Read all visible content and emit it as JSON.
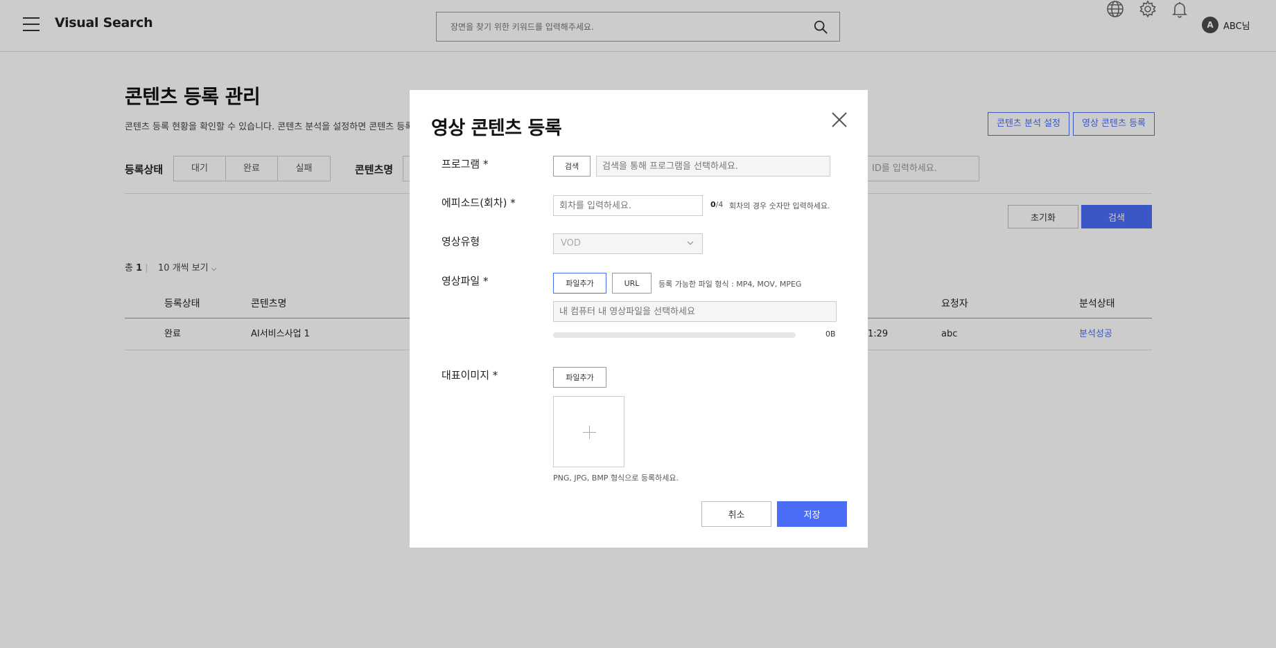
{
  "app": {
    "title": "Visual Search",
    "search_placeholder": "장면을 찾기 위한 키워드를 입력해주세요.",
    "user_initial": "A",
    "user_name": "ABC님"
  },
  "page": {
    "title": "콘텐츠 등록 관리",
    "description": "콘텐츠 등록 현황을 확인할 수 있습니다. 콘텐츠 분석을 설정하면 콘텐츠 등록",
    "analysis_settings_button": "콘텐츠 분석 설정",
    "register_video_button": "영상 콘텐츠 등록"
  },
  "filters": {
    "status_label": "등록상태",
    "status_options": [
      "대기",
      "완료",
      "실패"
    ],
    "content_name_label": "콘텐츠명",
    "id_placeholder": "ID를 입력하세요.",
    "reset_button": "초기화",
    "search_button": "검색"
  },
  "list": {
    "total_prefix": "총",
    "total_count": "1",
    "per_page": "10 개씩 보기",
    "columns": {
      "status": "등록상태",
      "content_name": "콘텐츠명",
      "requester": "요청자",
      "analysis_status": "분석상태"
    },
    "rows": [
      {
        "status": "완료",
        "content_name": "AI서비스사업 1",
        "time": "1:29",
        "requester": "abc",
        "analysis_status": "분석성공"
      }
    ]
  },
  "modal": {
    "title": "영상 콘텐츠 등록",
    "program": {
      "label": "프로그램 *",
      "search_button": "검색",
      "placeholder": "검색을 통해 프로그램을 선택하세요."
    },
    "episode": {
      "label": "에피소드(회차) *",
      "placeholder": "회차를 입력하세요.",
      "count_current": "0",
      "count_max": "/4",
      "hint": "회차의 경우 숫자만 입력하세요."
    },
    "video_type": {
      "label": "영상유형",
      "value": "VOD"
    },
    "video_file": {
      "label": "영상파일 *",
      "add_file_button": "파일추가",
      "url_button": "URL",
      "formats_hint": "등록 가능한 파일 형식 : MP4, MOV, MPEG",
      "placeholder": "내 컴퓨터 내 영상파일을 선택하세요",
      "upload_size": "0B",
      "progress": 0
    },
    "thumbnail": {
      "label": "대표이미지 *",
      "add_file_button": "파일추가",
      "formats_hint": "PNG, JPG, BMP 형식으로 등록하세요."
    },
    "cancel_button": "취소",
    "save_button": "저장"
  },
  "colors": {
    "accent": "#4a6cf7",
    "overlay": "rgba(0,0,0,0.2)"
  },
  "icons": {
    "menu": "hamburger-menu-icon",
    "search": "search-icon",
    "language": "globe-icon",
    "settings": "gear-icon",
    "notifications": "bell-icon",
    "close": "close-icon",
    "dropdown": "chevron-down-icon",
    "add_image": "plus-icon"
  }
}
